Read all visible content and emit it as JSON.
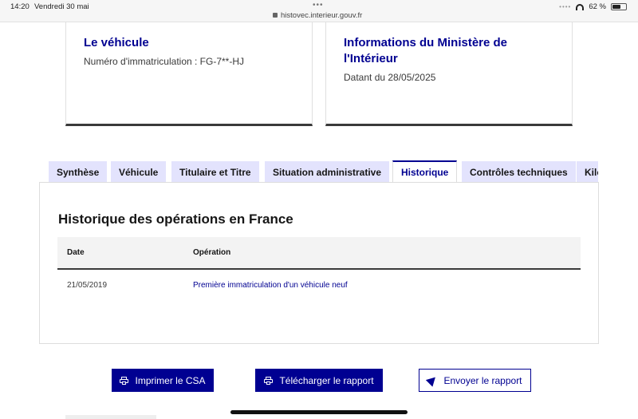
{
  "status_bar": {
    "time": "14:20",
    "date": "Vendredi 30 mai",
    "dots": "•••",
    "url": "histovec.interieur.gouv.fr",
    "battery": "62 %"
  },
  "cards": {
    "vehicle": {
      "title": "Le véhicule",
      "text": "Numéro d'immatriculation : FG-7**-HJ"
    },
    "ministry": {
      "title": "Informations du Ministère de l'Intérieur",
      "text": "Datant du 28/05/2025"
    }
  },
  "tabs": [
    {
      "label": "Synthèse",
      "active": false
    },
    {
      "label": "Véhicule",
      "active": false
    },
    {
      "label": "Titulaire et Titre",
      "active": false
    },
    {
      "label": "Situation administrative",
      "active": false
    },
    {
      "label": "Historique",
      "active": true
    },
    {
      "label": "Contrôles techniques",
      "active": false
    },
    {
      "label": "Kilo",
      "active": false
    }
  ],
  "history": {
    "title": "Historique des opérations en France",
    "columns": [
      "Date",
      "Opération"
    ],
    "rows": [
      {
        "date": "21/05/2019",
        "operation": "Première immatriculation d'un véhicule neuf"
      }
    ]
  },
  "actions": {
    "print_label": "Imprimer le CSA",
    "download_label": "Télécharger le rapport",
    "send_label": "Envoyer le rapport"
  },
  "colors": {
    "accent": "#000091",
    "tab_inactive": "#e3e3fd",
    "table_header": "#f3f3f3"
  }
}
